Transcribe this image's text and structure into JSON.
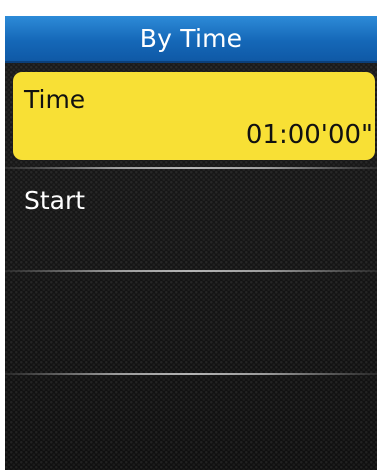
{
  "header": {
    "title": "By Time"
  },
  "menu": {
    "items": [
      {
        "label": "Time",
        "value": "01:00'00\""
      },
      {
        "label": "Start"
      }
    ]
  },
  "colors": {
    "header_blue": "#1568b8",
    "selected_yellow": "#f8e035",
    "background": "#151515",
    "text_light": "#ffffff",
    "text_dark": "#111111"
  }
}
